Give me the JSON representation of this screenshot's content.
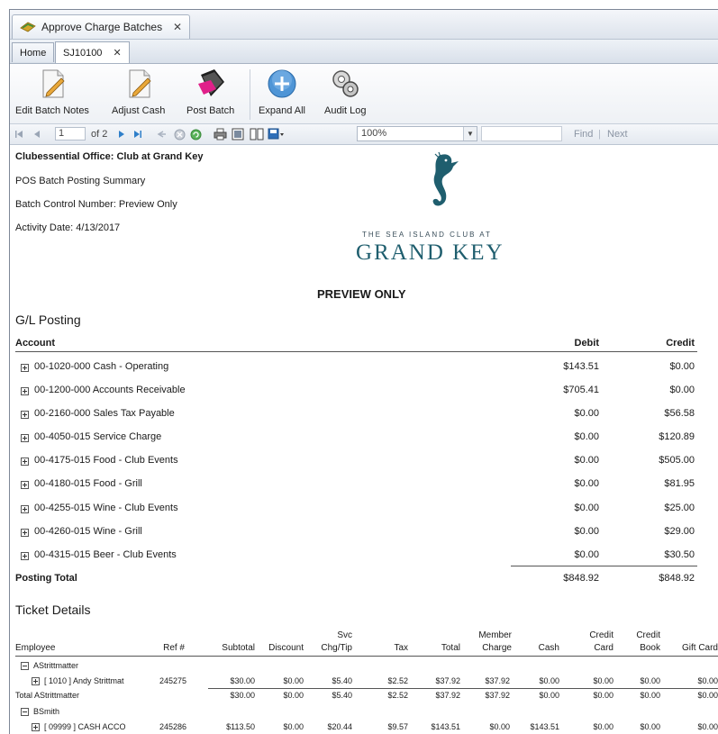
{
  "window": {
    "tab_title": "Approve Charge Batches",
    "tab_close": "✕"
  },
  "subtabs": [
    {
      "label": "Home"
    },
    {
      "label": "SJ10100",
      "close": "✕"
    }
  ],
  "toolbar": {
    "edit_batch_notes": "Edit Batch Notes",
    "adjust_cash": "Adjust Cash",
    "post_batch": "Post Batch",
    "expand_all": "Expand All",
    "audit_log": "Audit Log"
  },
  "nav": {
    "page": "1",
    "of_pages": "of 2",
    "zoom": "100%",
    "find": "Find",
    "sep": "|",
    "next": "Next"
  },
  "report": {
    "office": "Clubessential Office: Club at Grand Key",
    "summary": "POS Batch Posting Summary",
    "batch_control": "Batch Control Number: Preview Only",
    "activity_date": "Activity Date: 4/13/2017",
    "logo_line1": "THE SEA ISLAND CLUB AT",
    "logo_line2": "GRAND KEY",
    "preview": "PREVIEW ONLY",
    "gl_title": "G/L Posting",
    "gl_headers": {
      "account": "Account",
      "debit": "Debit",
      "credit": "Credit"
    },
    "gl_rows": [
      {
        "account": "00-1020-000 Cash - Operating",
        "debit": "$143.51",
        "credit": "$0.00"
      },
      {
        "account": "00-1200-000 Accounts Receivable",
        "debit": "$705.41",
        "credit": "$0.00"
      },
      {
        "account": "00-2160-000 Sales Tax Payable",
        "debit": "$0.00",
        "credit": "$56.58"
      },
      {
        "account": "00-4050-015 Service Charge",
        "debit": "$0.00",
        "credit": "$120.89"
      },
      {
        "account": "00-4175-015 Food - Club Events",
        "debit": "$0.00",
        "credit": "$505.00"
      },
      {
        "account": "00-4180-015 Food - Grill",
        "debit": "$0.00",
        "credit": "$81.95"
      },
      {
        "account": "00-4255-015 Wine - Club Events",
        "debit": "$0.00",
        "credit": "$25.00"
      },
      {
        "account": "00-4260-015 Wine - Grill",
        "debit": "$0.00",
        "credit": "$29.00"
      },
      {
        "account": "00-4315-015 Beer - Club Events",
        "debit": "$0.00",
        "credit": "$30.50"
      }
    ],
    "posting_total": {
      "label": "Posting Total",
      "debit": "$848.92",
      "credit": "$848.92"
    },
    "ticket_title": "Ticket Details",
    "ticket_headers": {
      "employee": "Employee",
      "ref": "Ref #",
      "subtotal": "Subtotal",
      "discount": "Discount",
      "svc1": "Svc",
      "svc2": "Chg/Tip",
      "tax": "Tax",
      "total": "Total",
      "member1": "Member",
      "member2": "Charge",
      "cash": "Cash",
      "ccard1": "Credit",
      "ccard2": "Card",
      "cbook1": "Credit",
      "cbook2": "Book",
      "gift": "Gift Card"
    },
    "groups": [
      {
        "name": "AStrittmatter",
        "row": {
          "employee": "[ 1010 ] Andy Strittmat",
          "ref": "245275",
          "subtotal": "$30.00",
          "discount": "$0.00",
          "svc": "$5.40",
          "tax": "$2.52",
          "total": "$37.92",
          "member": "$37.92",
          "cash": "$0.00",
          "ccard": "$0.00",
          "cbook": "$0.00",
          "gift": "$0.00"
        },
        "total": {
          "label": "Total AStrittmatter",
          "subtotal": "$30.00",
          "discount": "$0.00",
          "svc": "$5.40",
          "tax": "$2.52",
          "total": "$37.92",
          "member": "$37.92",
          "cash": "$0.00",
          "ccard": "$0.00",
          "cbook": "$0.00",
          "gift": "$0.00"
        }
      },
      {
        "name": "BSmith",
        "row": {
          "employee": "[ 09999 ] CASH ACCO",
          "ref": "245286",
          "subtotal": "$113.50",
          "discount": "$0.00",
          "svc": "$20.44",
          "tax": "$9.57",
          "total": "$143.51",
          "member": "$0.00",
          "cash": "$143.51",
          "ccard": "$0.00",
          "cbook": "$0.00",
          "gift": "$0.00"
        }
      }
    ]
  },
  "colors": {
    "accent_blue": "#2f7fc9",
    "logo_teal": "#1f5e6e",
    "post_magenta": "#e0208a"
  }
}
